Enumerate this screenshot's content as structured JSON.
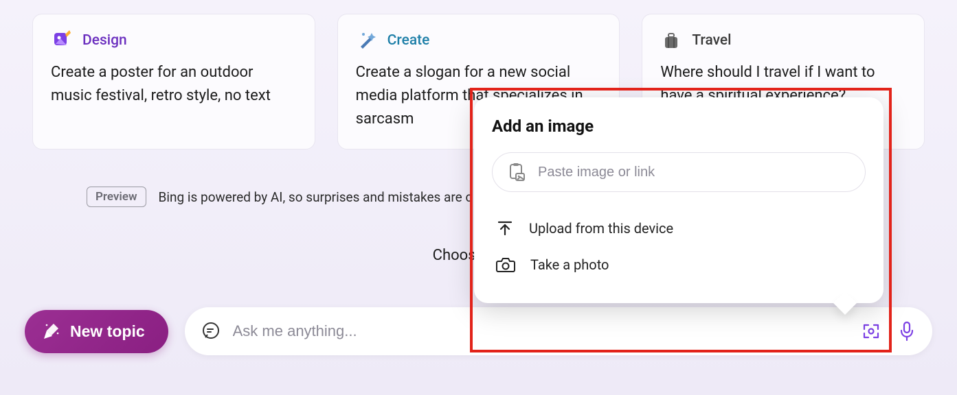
{
  "cards": [
    {
      "title": "Design",
      "title_color": "#6b2fbf",
      "body": "Create a poster for an outdoor music festival, retro style, no text"
    },
    {
      "title": "Create",
      "title_color": "#1e7fa8",
      "body": "Create a slogan for a new social media platform that specializes in sarcasm"
    },
    {
      "title": "Travel",
      "title_color": "#3a3a3a",
      "body": "Where should I travel if I want to have a spiritual experience?"
    }
  ],
  "preview": {
    "badge": "Preview",
    "text": "Bing is powered by AI, so surprises and mistakes are c"
  },
  "choose_style": "Choose a con",
  "new_topic": "New topic",
  "ask_placeholder": "Ask me anything...",
  "popup": {
    "title": "Add an image",
    "paste_placeholder": "Paste image or link",
    "upload": "Upload from this device",
    "take_photo": "Take a photo"
  }
}
